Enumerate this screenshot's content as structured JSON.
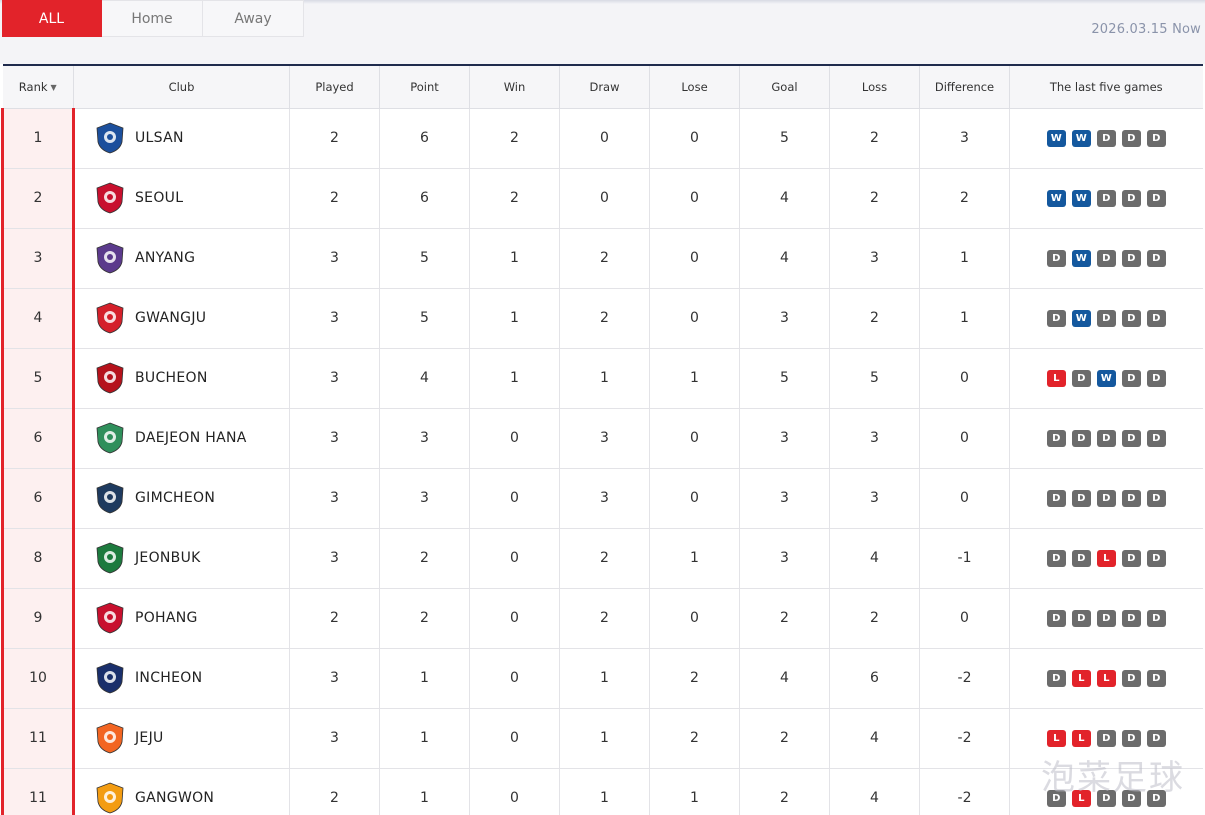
{
  "tabs": [
    {
      "label": "ALL",
      "active": true
    },
    {
      "label": "Home",
      "active": false
    },
    {
      "label": "Away",
      "active": false
    }
  ],
  "date_stamp": "2026.03.15 Now",
  "columns": [
    "Rank",
    "Club",
    "Played",
    "Point",
    "Win",
    "Draw",
    "Lose",
    "Goal",
    "Loss",
    "Difference",
    "The last five games"
  ],
  "colors": {
    "accent": "#e2232a",
    "win": "#14589e",
    "draw": "#6b6b6b",
    "loss": "#e2232a",
    "header_border": "#1f2b4d"
  },
  "rows": [
    {
      "rank": "1",
      "club": "ULSAN",
      "crest_icon": "ulsan-crest-icon",
      "crest_color": "#1c4f9c",
      "played": "2",
      "point": "6",
      "win": "2",
      "draw": "0",
      "lose": "0",
      "goal": "5",
      "loss": "2",
      "diff": "3",
      "form": [
        "W",
        "W",
        "D",
        "D",
        "D"
      ]
    },
    {
      "rank": "2",
      "club": "SEOUL",
      "crest_icon": "seoul-crest-icon",
      "crest_color": "#c8102e",
      "played": "2",
      "point": "6",
      "win": "2",
      "draw": "0",
      "lose": "0",
      "goal": "4",
      "loss": "2",
      "diff": "2",
      "form": [
        "W",
        "W",
        "D",
        "D",
        "D"
      ]
    },
    {
      "rank": "3",
      "club": "ANYANG",
      "crest_icon": "anyang-crest-icon",
      "crest_color": "#5b3a8c",
      "played": "3",
      "point": "5",
      "win": "1",
      "draw": "2",
      "lose": "0",
      "goal": "4",
      "loss": "3",
      "diff": "1",
      "form": [
        "D",
        "W",
        "D",
        "D",
        "D"
      ]
    },
    {
      "rank": "4",
      "club": "GWANGJU",
      "crest_icon": "gwangju-crest-icon",
      "crest_color": "#d4202a",
      "played": "3",
      "point": "5",
      "win": "1",
      "draw": "2",
      "lose": "0",
      "goal": "3",
      "loss": "2",
      "diff": "1",
      "form": [
        "D",
        "W",
        "D",
        "D",
        "D"
      ]
    },
    {
      "rank": "5",
      "club": "BUCHEON",
      "crest_icon": "bucheon-crest-icon",
      "crest_color": "#b5121b",
      "played": "3",
      "point": "4",
      "win": "1",
      "draw": "1",
      "lose": "1",
      "goal": "5",
      "loss": "5",
      "diff": "0",
      "form": [
        "L",
        "D",
        "W",
        "D",
        "D"
      ]
    },
    {
      "rank": "6",
      "club": "DAEJEON HANA",
      "crest_icon": "daejeon-crest-icon",
      "crest_color": "#2f8f5b",
      "played": "3",
      "point": "3",
      "win": "0",
      "draw": "3",
      "lose": "0",
      "goal": "3",
      "loss": "3",
      "diff": "0",
      "form": [
        "D",
        "D",
        "D",
        "D",
        "D"
      ]
    },
    {
      "rank": "6",
      "club": "GIMCHEON",
      "crest_icon": "gimcheon-crest-icon",
      "crest_color": "#1e3a5f",
      "played": "3",
      "point": "3",
      "win": "0",
      "draw": "3",
      "lose": "0",
      "goal": "3",
      "loss": "3",
      "diff": "0",
      "form": [
        "D",
        "D",
        "D",
        "D",
        "D"
      ]
    },
    {
      "rank": "8",
      "club": "JEONBUK",
      "crest_icon": "jeonbuk-crest-icon",
      "crest_color": "#1d7a3e",
      "played": "3",
      "point": "2",
      "win": "0",
      "draw": "2",
      "lose": "1",
      "goal": "3",
      "loss": "4",
      "diff": "-1",
      "form": [
        "D",
        "D",
        "L",
        "D",
        "D"
      ]
    },
    {
      "rank": "9",
      "club": "POHANG",
      "crest_icon": "pohang-crest-icon",
      "crest_color": "#c8102e",
      "played": "2",
      "point": "2",
      "win": "0",
      "draw": "2",
      "lose": "0",
      "goal": "2",
      "loss": "2",
      "diff": "0",
      "form": [
        "D",
        "D",
        "D",
        "D",
        "D"
      ]
    },
    {
      "rank": "10",
      "club": "INCHEON",
      "crest_icon": "incheon-crest-icon",
      "crest_color": "#1a2f6b",
      "played": "3",
      "point": "1",
      "win": "0",
      "draw": "1",
      "lose": "2",
      "goal": "4",
      "loss": "6",
      "diff": "-2",
      "form": [
        "D",
        "L",
        "L",
        "D",
        "D"
      ]
    },
    {
      "rank": "11",
      "club": "JEJU",
      "crest_icon": "jeju-crest-icon",
      "crest_color": "#f26522",
      "played": "3",
      "point": "1",
      "win": "0",
      "draw": "1",
      "lose": "2",
      "goal": "2",
      "loss": "4",
      "diff": "-2",
      "form": [
        "L",
        "L",
        "D",
        "D",
        "D"
      ]
    },
    {
      "rank": "11",
      "club": "GANGWON",
      "crest_icon": "gangwon-crest-icon",
      "crest_color": "#f39c12",
      "played": "2",
      "point": "1",
      "win": "0",
      "draw": "1",
      "lose": "1",
      "goal": "2",
      "loss": "4",
      "diff": "-2",
      "form": [
        "D",
        "L",
        "D",
        "D",
        "D"
      ]
    }
  ],
  "watermark": "泡菜足球"
}
